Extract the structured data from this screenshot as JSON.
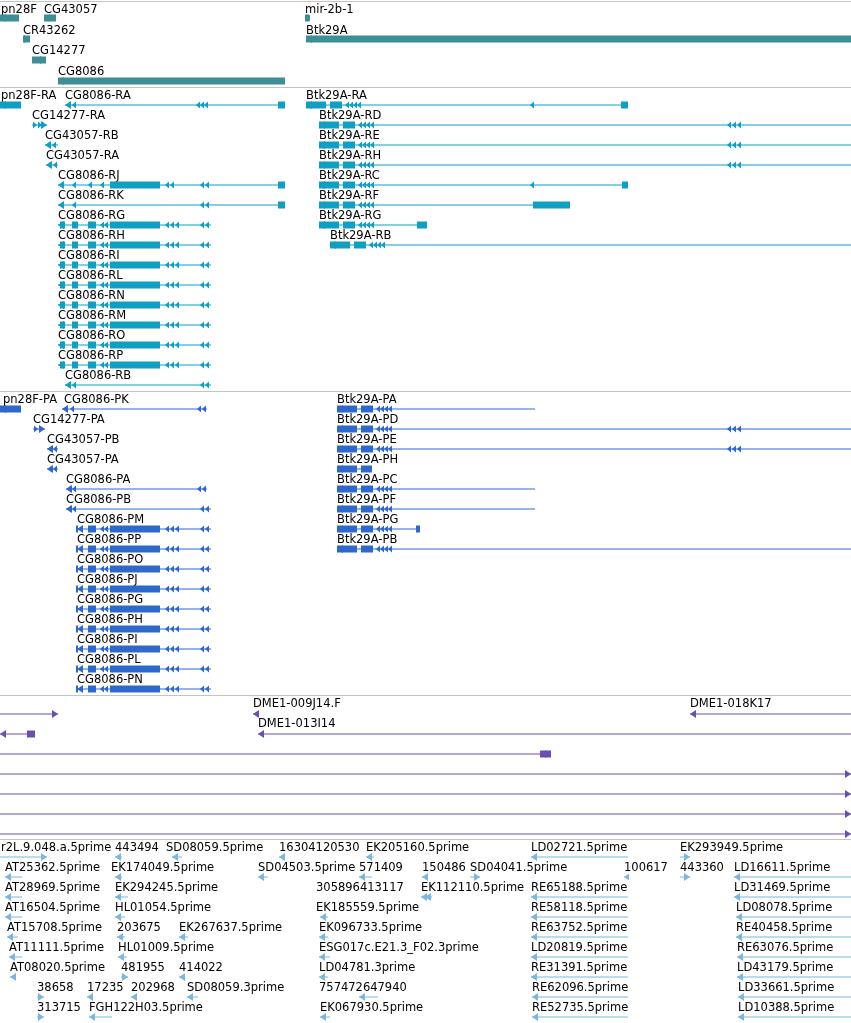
{
  "tracks": [
    {
      "kind": "gene",
      "features": [
        {
          "label": "pn28F",
          "reverse": true
        },
        {
          "label": "CG43057",
          "reverse": true
        },
        {
          "label": "mir-2b-1",
          "reverse": true
        },
        {
          "label": "CR43262",
          "reverse": false
        },
        {
          "label": "Btk29A",
          "reverse": true
        },
        {
          "label": "CG14277",
          "reverse": false
        },
        {
          "label": "CG8086",
          "reverse": true
        }
      ]
    },
    {
      "kind": "transcript",
      "features": [
        {
          "label": "pn28F-RA",
          "reverse": true
        },
        {
          "label": "CG8086-RA",
          "reverse": true
        },
        {
          "label": "Btk29A-RA",
          "reverse": true
        },
        {
          "label": "CG14277-RA",
          "reverse": false
        },
        {
          "label": "Btk29A-RD",
          "reverse": true
        },
        {
          "label": "CG43057-RB",
          "reverse": true
        },
        {
          "label": "Btk29A-RE",
          "reverse": true
        },
        {
          "label": "CG43057-RA",
          "reverse": true
        },
        {
          "label": "Btk29A-RH",
          "reverse": true
        },
        {
          "label": "CG8086-RJ",
          "reverse": true
        },
        {
          "label": "Btk29A-RC",
          "reverse": true
        },
        {
          "label": "CG8086-RK",
          "reverse": true
        },
        {
          "label": "Btk29A-RF",
          "reverse": true
        },
        {
          "label": "CG8086-RG",
          "reverse": true
        },
        {
          "label": "Btk29A-RG",
          "reverse": true
        },
        {
          "label": "CG8086-RH",
          "reverse": true
        },
        {
          "label": "Btk29A-RB",
          "reverse": true
        },
        {
          "label": "CG8086-RI",
          "reverse": true
        },
        {
          "label": "CG8086-RL",
          "reverse": true
        },
        {
          "label": "CG8086-RN",
          "reverse": true
        },
        {
          "label": "CG8086-RM",
          "reverse": true
        },
        {
          "label": "CG8086-RO",
          "reverse": true
        },
        {
          "label": "CG8086-RP",
          "reverse": true
        },
        {
          "label": "CG8086-RB",
          "reverse": true
        }
      ]
    },
    {
      "kind": "protein",
      "features": [
        {
          "label": "pn28F-PA",
          "reverse": true
        },
        {
          "label": "CG8086-PK",
          "reverse": true
        },
        {
          "label": "Btk29A-PA",
          "reverse": true
        },
        {
          "label": "CG14277-PA",
          "reverse": false
        },
        {
          "label": "Btk29A-PD",
          "reverse": true
        },
        {
          "label": "CG43057-PB",
          "reverse": true
        },
        {
          "label": "Btk29A-PE",
          "reverse": true
        },
        {
          "label": "CG43057-PA",
          "reverse": true
        },
        {
          "label": "Btk29A-PH",
          "reverse": true
        },
        {
          "label": "CG8086-PA",
          "reverse": true
        },
        {
          "label": "Btk29A-PC",
          "reverse": true
        },
        {
          "label": "CG8086-PB",
          "reverse": true
        },
        {
          "label": "Btk29A-PF",
          "reverse": true
        },
        {
          "label": "CG8086-PM",
          "reverse": true
        },
        {
          "label": "Btk29A-PG",
          "reverse": true
        },
        {
          "label": "CG8086-PP",
          "reverse": true
        },
        {
          "label": "Btk29A-PB",
          "reverse": true
        },
        {
          "label": "CG8086-PO",
          "reverse": true
        },
        {
          "label": "CG8086-PJ",
          "reverse": true
        },
        {
          "label": "CG8086-PG",
          "reverse": true
        },
        {
          "label": "CG8086-PH",
          "reverse": true
        },
        {
          "label": "CG8086-PI",
          "reverse": true
        },
        {
          "label": "CG8086-PL",
          "reverse": true
        },
        {
          "label": "CG8086-PN",
          "reverse": true
        }
      ]
    },
    {
      "kind": "clone",
      "features": [
        {
          "reverse": false
        },
        {
          "label": "DME1-009J14.F",
          "reverse": true
        },
        {
          "label": "DME1-018K17",
          "reverse": true
        },
        {
          "label": "DME1-013I14",
          "reverse": true
        },
        {
          "reverse": true
        },
        {
          "reverse": false
        },
        {
          "reverse": false
        },
        {
          "reverse": false
        },
        {
          "reverse": false
        },
        {
          "reverse": false
        }
      ]
    },
    {
      "kind": "est",
      "features": [
        {
          "label": "r2L.9.048.a.5prime",
          "reverse": false
        },
        {
          "label": "443494",
          "reverse": true
        },
        {
          "label": "SD08059.5prime",
          "reverse": true
        },
        {
          "label": "16304120530",
          "reverse": true
        },
        {
          "label": "EK205160.5prime",
          "reverse": true
        },
        {
          "label": "LD02721.5prime",
          "reverse": true
        },
        {
          "label": "EK293949.5prime",
          "reverse": false
        },
        {
          "label": "AT25362.5prime",
          "reverse": true
        },
        {
          "label": "EK174049.5prime",
          "reverse": true
        },
        {
          "label": "SD04503.5prime",
          "reverse": true
        },
        {
          "label": "571409",
          "reverse": true
        },
        {
          "label": "150486",
          "reverse": true
        },
        {
          "label": "SD04041.5prime",
          "reverse": false
        },
        {
          "label": "100617",
          "reverse": true
        },
        {
          "label": "443360",
          "reverse": false
        },
        {
          "label": "LD16611.5prime",
          "reverse": true
        },
        {
          "label": "AT28969.5prime",
          "reverse": true
        },
        {
          "label": "EK294245.5prime",
          "reverse": true
        },
        {
          "label": "305896413117",
          "reverse": true
        },
        {
          "label": "EK112110.5prime",
          "reverse": true
        },
        {
          "label": "RE65188.5prime",
          "reverse": true
        },
        {
          "label": "LD31469.5prime",
          "reverse": true
        },
        {
          "label": "AT16504.5prime",
          "reverse": true
        },
        {
          "label": "HL01054.5prime",
          "reverse": true
        },
        {
          "label": "EK185559.5prime",
          "reverse": true
        },
        {
          "label": "RE58118.5prime",
          "reverse": true
        },
        {
          "label": "LD08078.5prime",
          "reverse": true
        },
        {
          "label": "AT15708.5prime",
          "reverse": true
        },
        {
          "label": "203675",
          "reverse": true
        },
        {
          "label": "EK267637.5prime",
          "reverse": true
        },
        {
          "label": "EK096733.5prime",
          "reverse": true
        },
        {
          "label": "RE63752.5prime",
          "reverse": true
        },
        {
          "label": "RE40458.5prime",
          "reverse": true
        },
        {
          "label": "AT11111.5prime",
          "reverse": true
        },
        {
          "label": "HL01009.5prime",
          "reverse": true
        },
        {
          "label": "ESG017c.E21.3_F02.3prime",
          "reverse": true
        },
        {
          "label": "LD20819.5prime",
          "reverse": true
        },
        {
          "label": "RE63076.5prime",
          "reverse": true
        },
        {
          "label": "AT08020.5prime",
          "reverse": true
        },
        {
          "label": "481955",
          "reverse": false
        },
        {
          "label": "414022",
          "reverse": true
        },
        {
          "label": "LD04781.3prime",
          "reverse": true
        },
        {
          "label": "RE31391.5prime",
          "reverse": true
        },
        {
          "label": "LD43179.5prime",
          "reverse": true
        },
        {
          "label": "38658",
          "reverse": false
        },
        {
          "label": "17235",
          "reverse": true
        },
        {
          "label": "202968",
          "reverse": true
        },
        {
          "label": "SD08059.3prime",
          "reverse": true
        },
        {
          "label": "757472647940",
          "reverse": true
        },
        {
          "label": "RE62096.5prime",
          "reverse": true
        },
        {
          "label": "LD33661.5prime",
          "reverse": true
        },
        {
          "label": "313715",
          "reverse": false
        },
        {
          "label": "FGH122H03.5prime",
          "reverse": true
        },
        {
          "label": "EK067930.5prime",
          "reverse": true
        },
        {
          "label": "RE52735.5prime",
          "reverse": true
        },
        {
          "label": "LD10388.5prime",
          "reverse": true
        }
      ]
    }
  ]
}
